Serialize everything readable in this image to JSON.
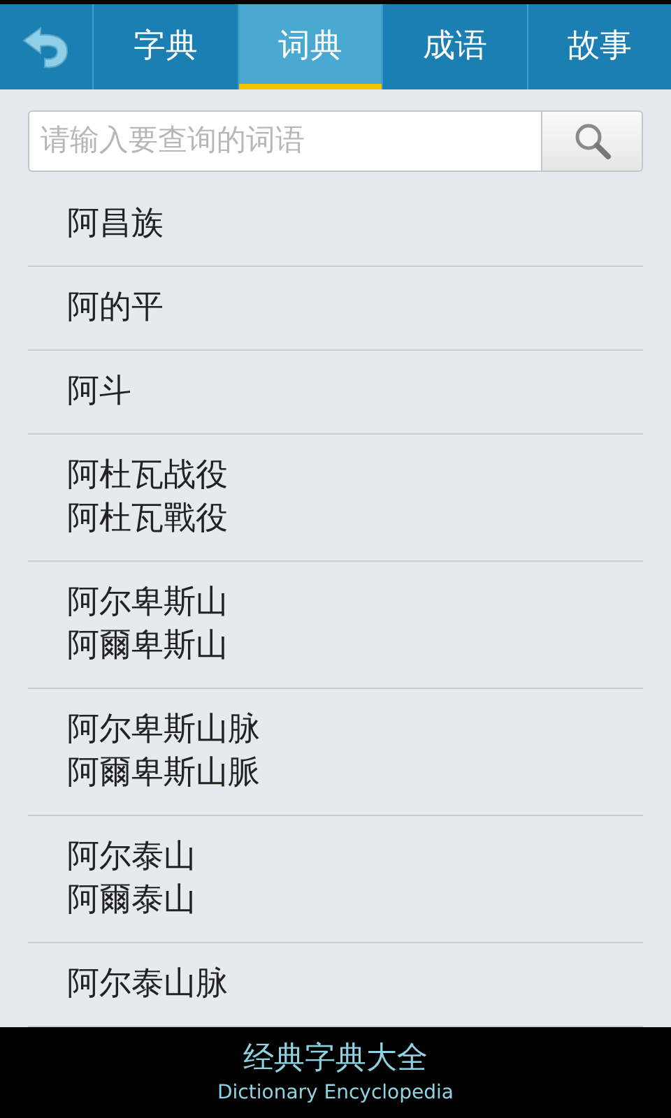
{
  "tabs": [
    {
      "label": "字典",
      "selected": false
    },
    {
      "label": "词典",
      "selected": true
    },
    {
      "label": "成语",
      "selected": false
    },
    {
      "label": "故事",
      "selected": false
    }
  ],
  "search": {
    "placeholder": "请输入要查询的词语"
  },
  "entries": [
    {
      "lines": [
        "阿昌族"
      ]
    },
    {
      "lines": [
        "阿的平"
      ]
    },
    {
      "lines": [
        "阿斗"
      ]
    },
    {
      "lines": [
        "阿杜瓦战役",
        "阿杜瓦戰役"
      ]
    },
    {
      "lines": [
        "阿尔卑斯山",
        "阿爾卑斯山"
      ]
    },
    {
      "lines": [
        "阿尔卑斯山脉",
        "阿爾卑斯山脈"
      ]
    },
    {
      "lines": [
        "阿尔泰山",
        "阿爾泰山"
      ]
    },
    {
      "lines": [
        "阿尔泰山脉"
      ]
    }
  ],
  "footer": {
    "title": "经典字典大全",
    "subtitle": "Dictionary Encyclopedia"
  }
}
